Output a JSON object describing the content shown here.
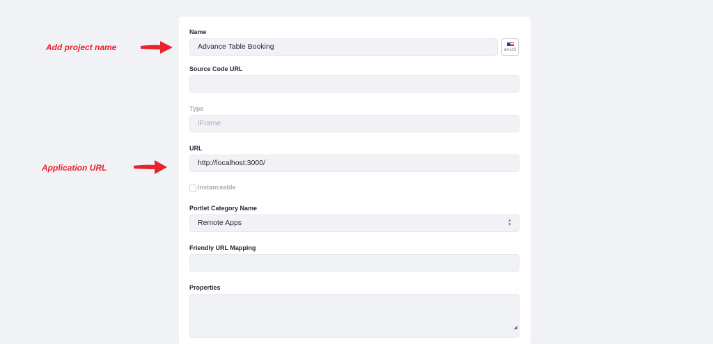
{
  "annotations": {
    "project_name": "Add project name",
    "application_url": "Application URL",
    "color": "#e8232b"
  },
  "form": {
    "name_label": "Name",
    "name_value": "Advance Table Booking",
    "language": "en-US",
    "source_code_label": "Source Code URL",
    "source_code_value": "",
    "type_label": "Type",
    "type_value": "IFrame",
    "url_label": "URL",
    "url_value": "http://localhost:3000/",
    "instanceable_label": "Instanceable",
    "instanceable_checked": false,
    "portlet_category_label": "Portlet Category Name",
    "portlet_category_value": "Remote Apps",
    "friendly_url_label": "Friendly URL Mapping",
    "friendly_url_value": "",
    "properties_label": "Properties",
    "properties_value": ""
  }
}
